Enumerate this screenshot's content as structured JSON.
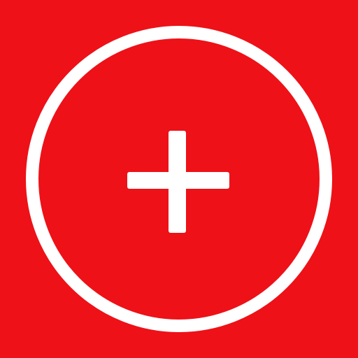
{
  "icon": {
    "name": "add-circle-icon",
    "description_name": "plus-icon"
  },
  "colors": {
    "background": "#EE1118",
    "foreground": "#FFFFFF"
  }
}
